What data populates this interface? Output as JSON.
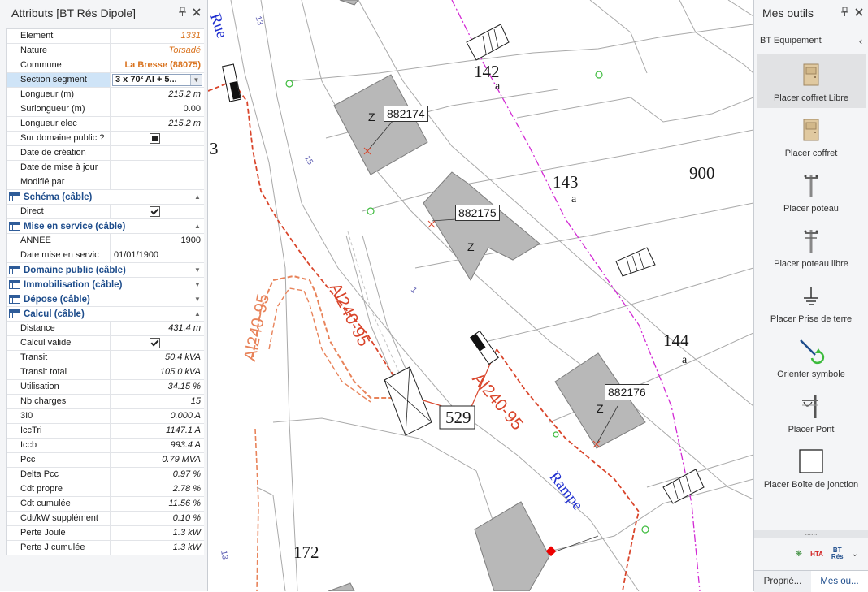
{
  "left_panel": {
    "title": "Attributs [BT Rés Dipole]",
    "pin_icon": "pin-icon",
    "close_icon": "close-icon",
    "rows_top": [
      {
        "key": "Element",
        "value": "1331",
        "style": "orange"
      },
      {
        "key": "Nature",
        "value": "Torsadé",
        "style": "orange"
      },
      {
        "key": "Commune",
        "value": "La Bresse (88075)",
        "style": "orange-bold"
      },
      {
        "key": "Section segment",
        "value": "3 x 70² Al + 5...",
        "style": "combo"
      },
      {
        "key": "Longueur (m)",
        "value": "215.2 m",
        "style": "italic"
      },
      {
        "key": "Surlongueur (m)",
        "value": "0.00",
        "style": "plain"
      },
      {
        "key": "Longueur elec",
        "value": "215.2 m",
        "style": "italic"
      },
      {
        "key": "Sur domaine public ?",
        "value": "",
        "style": "checkbox-filled"
      },
      {
        "key": "Date de création",
        "value": "",
        "style": "plain"
      },
      {
        "key": "Date de mise à jour",
        "value": "",
        "style": "plain"
      },
      {
        "key": "Modifié par",
        "value": "",
        "style": "plain"
      }
    ],
    "section_schema": "Schéma (câble)",
    "rows_schema": [
      {
        "key": "Direct",
        "value": "",
        "style": "checkbox-checked"
      }
    ],
    "section_mise": "Mise en service (câble)",
    "rows_mise": [
      {
        "key": "ANNEE",
        "value": "1900",
        "style": "plain"
      },
      {
        "key": "Date mise en servic",
        "value": "01/01/1900",
        "style": "left"
      }
    ],
    "section_domaine": "Domaine public (câble)",
    "section_immo": "Immobilisation (câble)",
    "section_depose": "Dépose (câble)",
    "section_calcul": "Calcul (câble)",
    "rows_calcul": [
      {
        "key": "Distance",
        "value": "431.4 m",
        "style": "italic"
      },
      {
        "key": "Calcul valide",
        "value": "",
        "style": "checkbox-checked"
      },
      {
        "key": "Transit",
        "value": "50.4 kVA",
        "style": "italic"
      },
      {
        "key": "Transit total",
        "value": "105.0 kVA",
        "style": "italic"
      },
      {
        "key": "Utilisation",
        "value": "34.15 %",
        "style": "italic"
      },
      {
        "key": "Nb charges",
        "value": "15",
        "style": "italic"
      },
      {
        "key": "3I0",
        "value": "0.000 A",
        "style": "italic"
      },
      {
        "key": "IccTri",
        "value": "1147.1 A",
        "style": "italic"
      },
      {
        "key": "Iccb",
        "value": "993.4 A",
        "style": "italic"
      },
      {
        "key": "Pcc",
        "value": "0.79 MVA",
        "style": "italic"
      },
      {
        "key": "Delta Pcc",
        "value": "0.97 %",
        "style": "italic"
      },
      {
        "key": "Cdt propre",
        "value": "2.78 %",
        "style": "italic"
      },
      {
        "key": "Cdt cumulée",
        "value": "11.56 %",
        "style": "italic"
      },
      {
        "key": "Cdt/kW supplément",
        "value": "0.10 %",
        "style": "italic"
      },
      {
        "key": "Perte Joule",
        "value": "1.3 kW",
        "style": "italic"
      },
      {
        "key": "Perte J cumulée",
        "value": "1.3 kW",
        "style": "italic"
      }
    ]
  },
  "map": {
    "parcels": [
      "142",
      "a",
      "143",
      "a",
      "900",
      "144",
      "a",
      "172",
      "3",
      "529"
    ],
    "building_ids": [
      "882174",
      "882175",
      "882176"
    ],
    "z_labels": [
      "Z",
      "Z",
      "Z"
    ],
    "street_labels": [
      "Rue",
      "Rampe"
    ],
    "cable_labels": [
      "Al240-95",
      "Al240-95",
      "Al240-95"
    ],
    "small_numbers": [
      "13",
      "15",
      "1",
      "13"
    ],
    "colors": {
      "cable_red": "#d9452b",
      "cable_orange": "#e8835a",
      "boundary_magenta": "#d22ad4",
      "street_blue": "#1f2fcf",
      "building_gray": "#b7b7b7",
      "node_green": "#3dbb3d"
    }
  },
  "right_panel": {
    "title": "Mes outils",
    "subheader": "BT Equipement",
    "tools": [
      {
        "label": "Placer coffret Libre",
        "icon": "cabinet-icon",
        "active": true
      },
      {
        "label": "Placer coffret",
        "icon": "cabinet-icon",
        "active": false
      },
      {
        "label": "Placer poteau",
        "icon": "pole-icon",
        "active": false
      },
      {
        "label": "Placer poteau libre",
        "icon": "pole-free-icon",
        "active": false
      },
      {
        "label": "Placer Prise de terre",
        "icon": "ground-icon",
        "active": false
      },
      {
        "label": "Orienter symbole",
        "icon": "rotate-symbol-icon",
        "active": false
      },
      {
        "label": "Placer Pont",
        "icon": "bridge-icon",
        "active": false
      },
      {
        "label": "Placer Boîte de jonction",
        "icon": "junction-box-icon",
        "active": false
      }
    ],
    "mini_hta": "HTA",
    "mini_bt": "BT",
    "mini_res": "Rés",
    "tabs": [
      {
        "label": "Proprié...",
        "active": false
      },
      {
        "label": "Mes ou...",
        "active": true
      }
    ]
  }
}
